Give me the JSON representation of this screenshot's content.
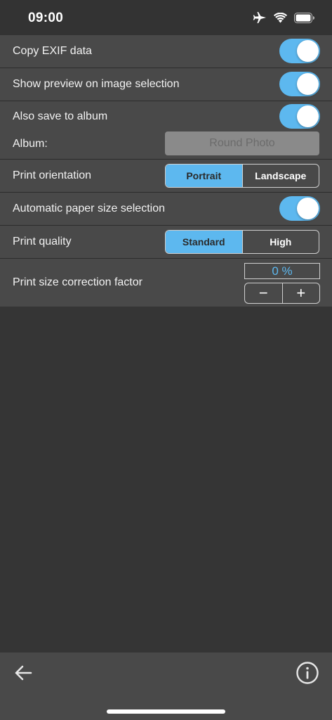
{
  "status_bar": {
    "time": "09:00",
    "icons": [
      "airplane-icon",
      "wifi-icon",
      "battery-icon"
    ]
  },
  "settings": {
    "copy_exif": {
      "label": "Copy EXIF data",
      "on": true
    },
    "show_preview": {
      "label": "Show preview on image selection",
      "on": true
    },
    "save_to_album": {
      "label": "Also save to album",
      "on": true
    },
    "album": {
      "label": "Album:",
      "value": "Round Photo"
    },
    "print_orientation": {
      "label": "Print orientation",
      "options": [
        "Portrait",
        "Landscape"
      ],
      "selected": "Portrait"
    },
    "auto_paper": {
      "label": "Automatic paper size selection",
      "on": true
    },
    "print_quality": {
      "label": "Print quality",
      "options": [
        "Standard",
        "High"
      ],
      "selected": "Standard"
    },
    "size_correction": {
      "label": "Print size correction factor",
      "value": "0 %",
      "decrement": "−",
      "increment": "+"
    }
  },
  "toolbar": {
    "back_icon": "arrow-left-icon",
    "info_icon": "info-icon"
  },
  "colors": {
    "accent": "#5db8ef",
    "row_bg": "#494949",
    "page_bg": "#353535"
  }
}
